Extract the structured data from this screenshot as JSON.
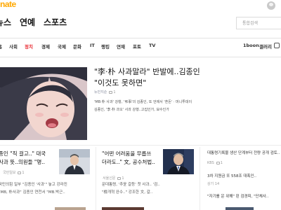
{
  "logo": {
    "text": "nate"
  },
  "sections": {
    "news": "뉴스",
    "entertainment": "연예",
    "sports": "스포츠"
  },
  "search": {
    "placeholder": "통합검색"
  },
  "categories": [
    "홈",
    "사회",
    "정치",
    "경제",
    "국제",
    "문화",
    "IT",
    "랭킹",
    "연재",
    "포토",
    "TV"
  ],
  "categories_right": [
    "1boon",
    "갤러리"
  ],
  "hero": {
    "title_line1": "\"李·朴 사과말라\" 반발에..김종인",
    "title_line2": "\"이것도 못하면\"",
    "source": "뉴민지순",
    "comments": "1",
    "desc_line1": "'MB·朴 사과' 강행, '弔事'의 김종인, 또 언에서 '혼돈' · 머니투데이",
    "desc_line2": "김종인, '李·朴 과오' 사과 강행..고집인가, 묘수인가"
  },
  "cards": {
    "left_title1": "종인 \"직 걸고..\" 대국",
    "left_title2": "사과 뜻..의원들 \"명..",
    "left_line1": "국민의힘 일부 \"김종인 '사과'\" 놓고 강라진",
    "left_line2": "\"MB, 朴사과\" 김종인 연천서 \"MB.박근..",
    "mid_title1": "\"어떤 어려움을 무릅쓰",
    "mid_title2": "더라도..\" 文, 공수처법..",
    "mid_meta": "서울신문",
    "mid_comments": "1",
    "mid_line1": "문대통령, '추윤 갈등' 첫 사과.. '검..",
    "mid_line2": "\"檢개혁 완수..\" 강조한 文, 갈..",
    "left_meta": "국민일보",
    "left_comments": "1",
    "side_line1": "대통령기록물 생산 단계부터 전량 공개 검토..",
    "side_line2": "3차 지원금 또 558조 대폭인..",
    "side_line3": "\"자기를 운 위해\" 핀 검경피, \"단체사..",
    "side_meta1": "KBS",
    "side_comments": "1",
    "side_meta2": "상기 14"
  },
  "colors": {
    "accent": "#e8272e",
    "logo": "#ffa800"
  }
}
